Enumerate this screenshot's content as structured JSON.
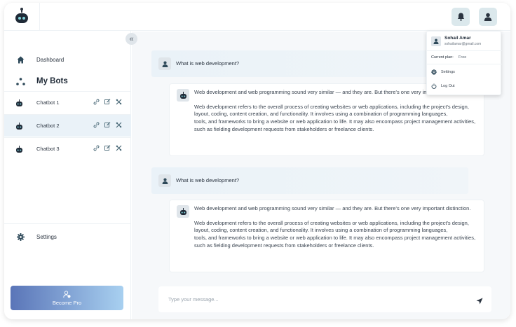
{
  "sidebar": {
    "dashboard_label": "Dashboard",
    "mybots_label": "My Bots",
    "bots": [
      {
        "label": "Chatbot 1"
      },
      {
        "label": "Chatbot 2"
      },
      {
        "label": "Chatbot 3"
      }
    ],
    "active_bot_index": 1,
    "settings_label": "Settings",
    "become_pro_label": "Become Pro"
  },
  "conversation": [
    {
      "question": "What is web development?",
      "answer_p1": "Web development and web programming sound very similar — and they are. But there's one very important distinction.",
      "answer_p2_line1": "Web development refers to the overall process of creating websites or web applications, including the project's design, layout, coding, content creation, and functionality. It involves using a combination of programming languages,",
      "answer_p2_line2": "tools, and frameworks to bring a website or web application to life. It may also encompass project management activities, such as fielding development requests from stakeholders or freelance clients."
    },
    {
      "question": "What is web development?",
      "answer_p1": "Web development and web programming sound very similar — and they are. But there's one very important distinction.",
      "answer_p2_line1": "Web development refers to the overall process of creating websites or web applications, including the project's design, layout, coding, content creation, and functionality. It involves using a combination of programming languages,",
      "answer_p2_line2": "tools, and frameworks to bring a website or web application to life. It may also encompass project management activities, such as fielding development requests from stakeholders or freelance clients."
    }
  ],
  "composer": {
    "placeholder": "Type your message...",
    "value": ""
  },
  "user_menu": {
    "name": "Sohail Amar",
    "email": "sohailamar@gmail.com",
    "plan_label": "Current plan:",
    "plan_value": "Free",
    "settings_label": "Settings",
    "logout_label": "Log Out"
  },
  "colors": {
    "accent_gradient_start": "#5a75b8",
    "accent_gradient_end": "#a8d0f0",
    "icon_bg": "#dbe8ec",
    "active_row_bg": "#eaf2f8"
  },
  "icons": {
    "logo": "robot-icon",
    "notifications": "bell-icon",
    "profile": "user-icon",
    "collapse": "double-chevron-left-icon",
    "dashboard": "home-icon",
    "mybots": "network-icon",
    "bot": "robot-icon",
    "bot_actions": [
      "link-icon",
      "edit-icon",
      "tools-icon"
    ],
    "settings": "gear-icon",
    "become_pro": "user-plus-icon",
    "send": "send-icon",
    "logout": "power-icon"
  }
}
